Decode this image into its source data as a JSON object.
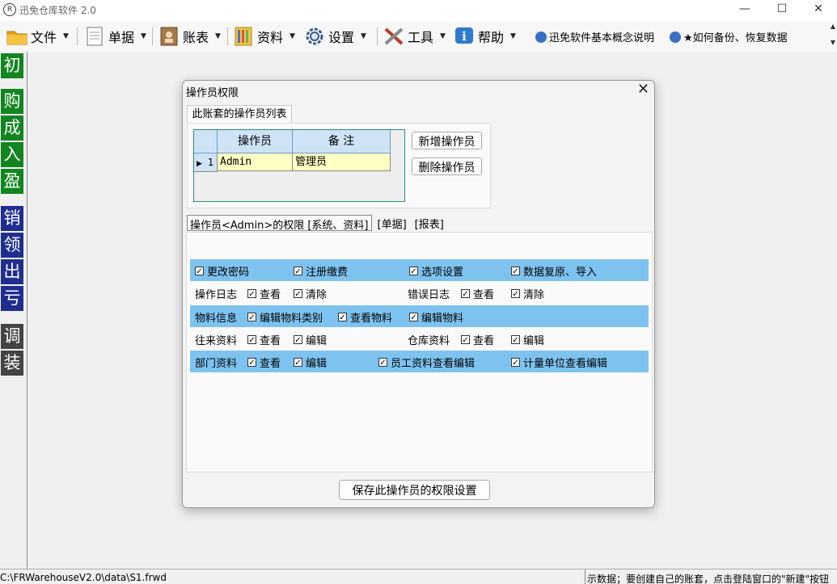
{
  "window": {
    "title": "迅免仓库软件 2.0",
    "icon_letter": "R",
    "minimize_glyph": "—",
    "maximize_glyph": "☐",
    "close_glyph": "✕"
  },
  "menubar": {
    "items": [
      {
        "label": "文件",
        "icon": "folder-icon"
      },
      {
        "label": "单据",
        "icon": "document-icon"
      },
      {
        "label": "账表",
        "icon": "ledger-icon"
      },
      {
        "label": "资料",
        "icon": "binder-icon"
      },
      {
        "label": "设置",
        "icon": "gear-icon"
      },
      {
        "label": "工具",
        "icon": "tools-icon"
      },
      {
        "label": "帮助",
        "icon": "info-icon"
      }
    ],
    "links": [
      {
        "label": "迅免软件基本概念说明",
        "icon": "globe-icon"
      },
      {
        "label": "★如何备份、恢复数据",
        "icon": "globe-icon"
      }
    ]
  },
  "leftbar": {
    "buttons": [
      {
        "label": "初",
        "color": "#12851f"
      },
      {
        "label": "购",
        "color": "#12851f"
      },
      {
        "label": "成",
        "color": "#12851f"
      },
      {
        "label": "入",
        "color": "#12851f"
      },
      {
        "label": "盈",
        "color": "#12851f"
      },
      {
        "label": "销",
        "color": "#1f2e8e"
      },
      {
        "label": "领",
        "color": "#1f2e8e"
      },
      {
        "label": "出",
        "color": "#1f2e8e"
      },
      {
        "label": "亏",
        "color": "#1f2e8e"
      },
      {
        "label": "调",
        "color": "#444444"
      },
      {
        "label": "装",
        "color": "#444444"
      }
    ]
  },
  "dialog": {
    "title": "操作员权限",
    "close_glyph": "✕",
    "operator_tab": "此账套的操作员列表",
    "grid": {
      "headers": [
        "操作员",
        "备 注"
      ],
      "rows": [
        {
          "marker": "▶",
          "index": "1",
          "operator": "Admin",
          "note": "管理员"
        }
      ]
    },
    "add_button": "新增操作员",
    "delete_button": "删除操作员",
    "perm_tabs": [
      "操作员<Admin>的权限 [系统、资料]",
      "[单据]",
      "[报表]"
    ],
    "permissions": {
      "row1": [
        {
          "label": "更改密码",
          "checked": true
        },
        {
          "label": "注册缴费",
          "checked": true
        },
        {
          "label": "选项设置",
          "checked": true
        },
        {
          "label": "数据复原、导入",
          "checked": true
        }
      ],
      "row2": {
        "label1": "操作日志",
        "items1": [
          {
            "label": "查看",
            "checked": true
          },
          {
            "label": "清除",
            "checked": true
          }
        ],
        "label2": "错误日志",
        "items2": [
          {
            "label": "查看",
            "checked": true
          },
          {
            "label": "清除",
            "checked": true
          }
        ]
      },
      "row3": {
        "label": "物料信息",
        "items": [
          {
            "label": "编辑物料类别",
            "checked": true
          },
          {
            "label": "查看物料",
            "checked": true
          },
          {
            "label": "编辑物料",
            "checked": true
          }
        ]
      },
      "row4": {
        "label1": "往来资料",
        "items1": [
          {
            "label": "查看",
            "checked": true
          },
          {
            "label": "编辑",
            "checked": true
          }
        ],
        "label2": "仓库资料",
        "items2": [
          {
            "label": "查看",
            "checked": true
          },
          {
            "label": "编辑",
            "checked": true
          }
        ]
      },
      "row5": {
        "label": "部门资料",
        "items": [
          {
            "label": "查看",
            "checked": true
          },
          {
            "label": "编辑",
            "checked": true
          },
          {
            "label": "员工资料查看编辑",
            "checked": true
          },
          {
            "label": "计量单位查看编辑",
            "checked": true
          }
        ]
      }
    },
    "save_button": "保存此操作员的权限设置"
  },
  "statusbar": {
    "path": "C:\\FRWarehouseV2.0\\data\\S1.frwd",
    "message": "示数据；要创建自己的账套，点击登陆窗口的\"新建\"按钮"
  },
  "checkmark": "✓"
}
